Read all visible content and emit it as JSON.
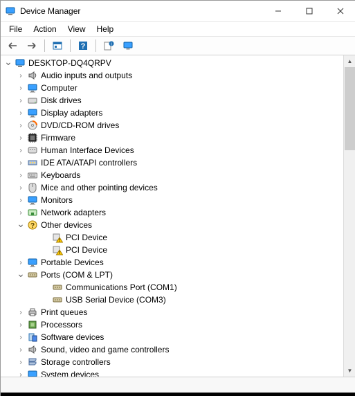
{
  "title": "Device Manager",
  "menu": {
    "file": "File",
    "action": "Action",
    "view": "View",
    "help": "Help"
  },
  "root": "DESKTOP-DQ4QRPV",
  "nodes": [
    {
      "label": "Audio inputs and outputs",
      "icon": "speaker-icon",
      "state": "collapsed"
    },
    {
      "label": "Computer",
      "icon": "monitor-icon",
      "state": "collapsed"
    },
    {
      "label": "Disk drives",
      "icon": "drive-icon",
      "state": "collapsed"
    },
    {
      "label": "Display adapters",
      "icon": "monitor-icon",
      "state": "collapsed"
    },
    {
      "label": "DVD/CD-ROM drives",
      "icon": "disc-icon",
      "state": "collapsed"
    },
    {
      "label": "Firmware",
      "icon": "chip-icon",
      "state": "collapsed"
    },
    {
      "label": "Human Interface Devices",
      "icon": "hid-icon",
      "state": "collapsed"
    },
    {
      "label": "IDE ATA/ATAPI controllers",
      "icon": "ide-icon",
      "state": "collapsed"
    },
    {
      "label": "Keyboards",
      "icon": "keyboard-icon",
      "state": "collapsed"
    },
    {
      "label": "Mice and other pointing devices",
      "icon": "mouse-icon",
      "state": "collapsed"
    },
    {
      "label": "Monitors",
      "icon": "monitor-icon",
      "state": "collapsed"
    },
    {
      "label": "Network adapters",
      "icon": "network-icon",
      "state": "collapsed"
    },
    {
      "label": "Other devices",
      "icon": "other-icon",
      "state": "expanded",
      "children": [
        {
          "label": "PCI Device",
          "icon": "warning-icon"
        },
        {
          "label": "PCI Device",
          "icon": "warning-icon"
        }
      ]
    },
    {
      "label": "Portable Devices",
      "icon": "monitor-icon",
      "state": "collapsed"
    },
    {
      "label": "Ports (COM & LPT)",
      "icon": "port-icon",
      "state": "expanded",
      "children": [
        {
          "label": "Communications Port (COM1)",
          "icon": "port-icon"
        },
        {
          "label": "USB Serial Device (COM3)",
          "icon": "port-icon"
        }
      ]
    },
    {
      "label": "Print queues",
      "icon": "printer-icon",
      "state": "collapsed"
    },
    {
      "label": "Processors",
      "icon": "cpu-icon",
      "state": "collapsed"
    },
    {
      "label": "Software devices",
      "icon": "software-icon",
      "state": "collapsed"
    },
    {
      "label": "Sound, video and game controllers",
      "icon": "speaker-icon",
      "state": "collapsed"
    },
    {
      "label": "Storage controllers",
      "icon": "storage-icon",
      "state": "collapsed"
    },
    {
      "label": "System devices",
      "icon": "monitor-icon",
      "state": "collapsed"
    }
  ]
}
